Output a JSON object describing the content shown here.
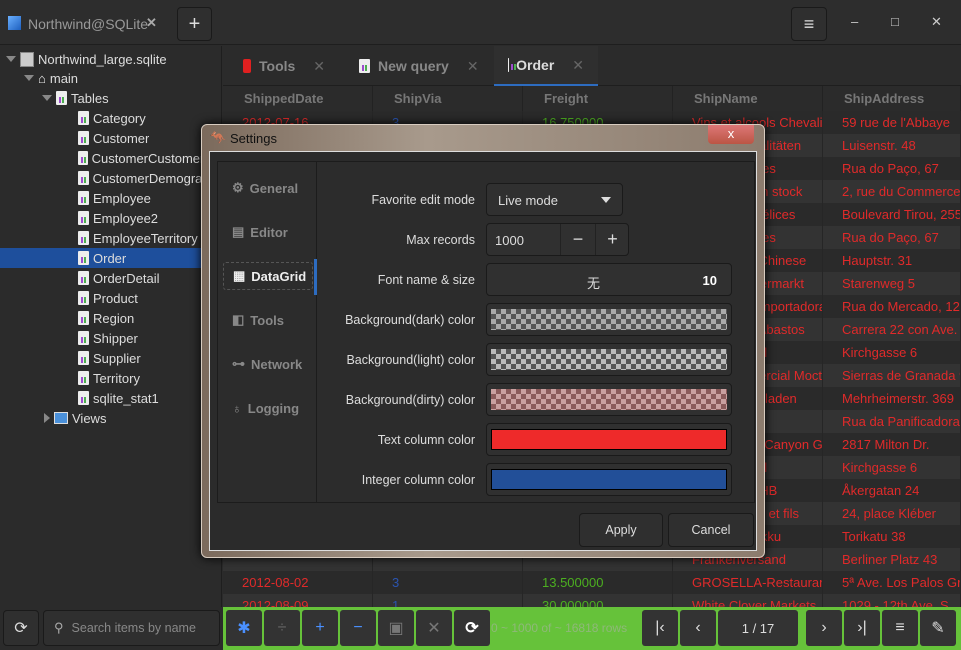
{
  "app": {
    "tab_title": "Northwind@SQLite",
    "new_tab": "+",
    "menu": "≡",
    "minimize": "–",
    "maximize": "□",
    "close": "✕"
  },
  "tree": {
    "db": "Northwind_large.sqlite",
    "schema": "main",
    "tables_label": "Tables",
    "tables": [
      "Category",
      "Customer",
      "CustomerCustomerDemo",
      "CustomerDemographic",
      "Employee",
      "Employee2",
      "EmployeeTerritory",
      "Order",
      "OrderDetail",
      "Product",
      "Region",
      "Shipper",
      "Supplier",
      "Territory",
      "sqlite_stat1"
    ],
    "selected": "Order",
    "views_label": "Views"
  },
  "search": {
    "placeholder": "Search items by name"
  },
  "tabs": [
    {
      "label": "Tools"
    },
    {
      "label": "New query"
    },
    {
      "label": "Order",
      "active": true
    }
  ],
  "grid": {
    "columns": [
      "ShippedDate",
      "ShipVia",
      "Freight",
      "ShipName",
      "ShipAddress"
    ],
    "rows": [
      [
        "2012-07-16",
        "3",
        "16.750000",
        "Vins et alcools Chevalier",
        "59 rue de l'Abbaye"
      ],
      [
        "",
        "",
        "",
        "Toms Spezialitäten",
        "Luisenstr. 48"
      ],
      [
        "",
        "",
        "",
        "Hanari Carnes",
        "Rua do Paço, 67"
      ],
      [
        "",
        "",
        "",
        "Victuailles en stock",
        "2, rue du Commerce"
      ],
      [
        "",
        "",
        "",
        "Suprêmes délices",
        "Boulevard Tirou, 255"
      ],
      [
        "",
        "",
        "",
        "Hanari Carnes",
        "Rua do Paço, 67"
      ],
      [
        "",
        "",
        "",
        "Chop-suey Chinese",
        "Hauptstr. 31"
      ],
      [
        "",
        "",
        "",
        "Richter Supermarkt",
        "Starenweg 5"
      ],
      [
        "",
        "",
        "",
        "Wellington Importadora",
        "Rua do Mercado, 12"
      ],
      [
        "",
        "",
        "",
        "HILARION-Abastos",
        "Carrera 22 con Ave."
      ],
      [
        "",
        "",
        "",
        "Ernst Handel",
        "Kirchgasse 6"
      ],
      [
        "",
        "",
        "",
        "Centro comercial Moctezuma",
        "Sierras de Granada 9"
      ],
      [
        "",
        "",
        "",
        "Ottilies Käseladen",
        "Mehrheimerstr. 369"
      ],
      [
        "",
        "",
        "",
        "Que Delícia",
        "Rua da Panificadora, 12"
      ],
      [
        "",
        "",
        "",
        "Rattlesnake Canyon Grocery",
        "2817 Milton Dr."
      ],
      [
        "",
        "",
        "",
        "Ernst Handel",
        "Kirchgasse 6"
      ],
      [
        "",
        "",
        "",
        "Folk och fä HB",
        "Åkergatan 24"
      ],
      [
        "",
        "",
        "",
        "Blondel père et fils",
        "24, place Kléber"
      ],
      [
        "",
        "",
        "",
        "Wartian Herkku",
        "Torikatu 38"
      ],
      [
        "",
        "",
        "",
        "Frankenversand",
        "Berliner Platz 43"
      ],
      [
        "2012-08-02",
        "3",
        "13.500000",
        "GROSELLA-Restaurante",
        "5ª Ave. Los Palos Grandes"
      ],
      [
        "2012-08-09",
        "1",
        "30.000000",
        "White Clover Markets",
        "1029 - 12th Ave. S."
      ]
    ]
  },
  "colors": {
    "text_column": "#ee2a2a",
    "integer_column": "#224f98",
    "float_column": "#4caf20",
    "toolbar": "#66c23a",
    "accent": "#2d6cc0"
  },
  "dialog": {
    "title": "Settings",
    "close": "x",
    "nav": [
      {
        "label": "General",
        "icon": "gear-icon"
      },
      {
        "label": "Editor",
        "icon": "notepad-icon"
      },
      {
        "label": "DataGrid",
        "icon": "grid-icon",
        "selected": true
      },
      {
        "label": "Tools",
        "icon": "tools-icon"
      },
      {
        "label": "Network",
        "icon": "network-icon"
      },
      {
        "label": "Logging",
        "icon": "bulb-icon"
      }
    ],
    "fields": {
      "edit_mode_label": "Favorite edit mode",
      "edit_mode_value": "Live mode",
      "max_records_label": "Max records",
      "max_records_value": "1000",
      "minus": "−",
      "plus": "+",
      "font_label": "Font name & size",
      "font_name": "无",
      "font_size": "10",
      "bg_dark_label": "Background(dark) color",
      "bg_light_label": "Background(light) color",
      "bg_dirty_label": "Background(dirty) color",
      "text_col_label": "Text column color",
      "int_col_label": "Integer column color"
    },
    "apply": "Apply",
    "cancel": "Cancel"
  },
  "toolbar": {
    "status": "0 ~ 1000 of ~ 16818 rows",
    "page": "1 / 17"
  }
}
